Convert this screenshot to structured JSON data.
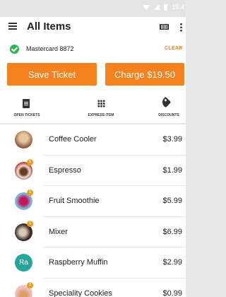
{
  "header": {
    "title": "All Items",
    "menu_icon": "hamburger-menu-icon",
    "barcode_icon": "barcode-icon",
    "overflow_icon": "overflow-menu-icon"
  },
  "status_bar": {
    "time": "15:4"
  },
  "payment": {
    "card_label": "Mastercard 8872",
    "clear_label": "CLEAR",
    "status_color": "#2db553"
  },
  "actions": {
    "save_label": "Save Ticket",
    "charge_label": "Charge $19.50",
    "accent_color": "#f6811f"
  },
  "tabs": [
    {
      "label": "OPEN TICKETS",
      "icon": "ticket-icon"
    },
    {
      "label": "EXPRESS ITEM",
      "icon": "grid-icon"
    },
    {
      "label": "DISCOUNTS",
      "icon": "tag-icon"
    }
  ],
  "items": [
    {
      "name": "Coffee Cooler",
      "price": "$3.99",
      "thumb": "photo",
      "badge": ""
    },
    {
      "name": "Espresso",
      "price": "$1.99",
      "thumb": "photo",
      "badge": "1"
    },
    {
      "name": "Fruit Smoothie",
      "price": "$5.99",
      "thumb": "photo",
      "badge": "1"
    },
    {
      "name": "Mixer",
      "price": "$6.99",
      "thumb": "photo",
      "badge": "1"
    },
    {
      "name": "Raspberry Muffin",
      "price": "$2.99",
      "thumb": "initials",
      "initials": "Ra",
      "badge": ""
    },
    {
      "name": "Speciality Cookies",
      "price": "$0.99",
      "thumb": "photo",
      "badge": "2"
    }
  ]
}
